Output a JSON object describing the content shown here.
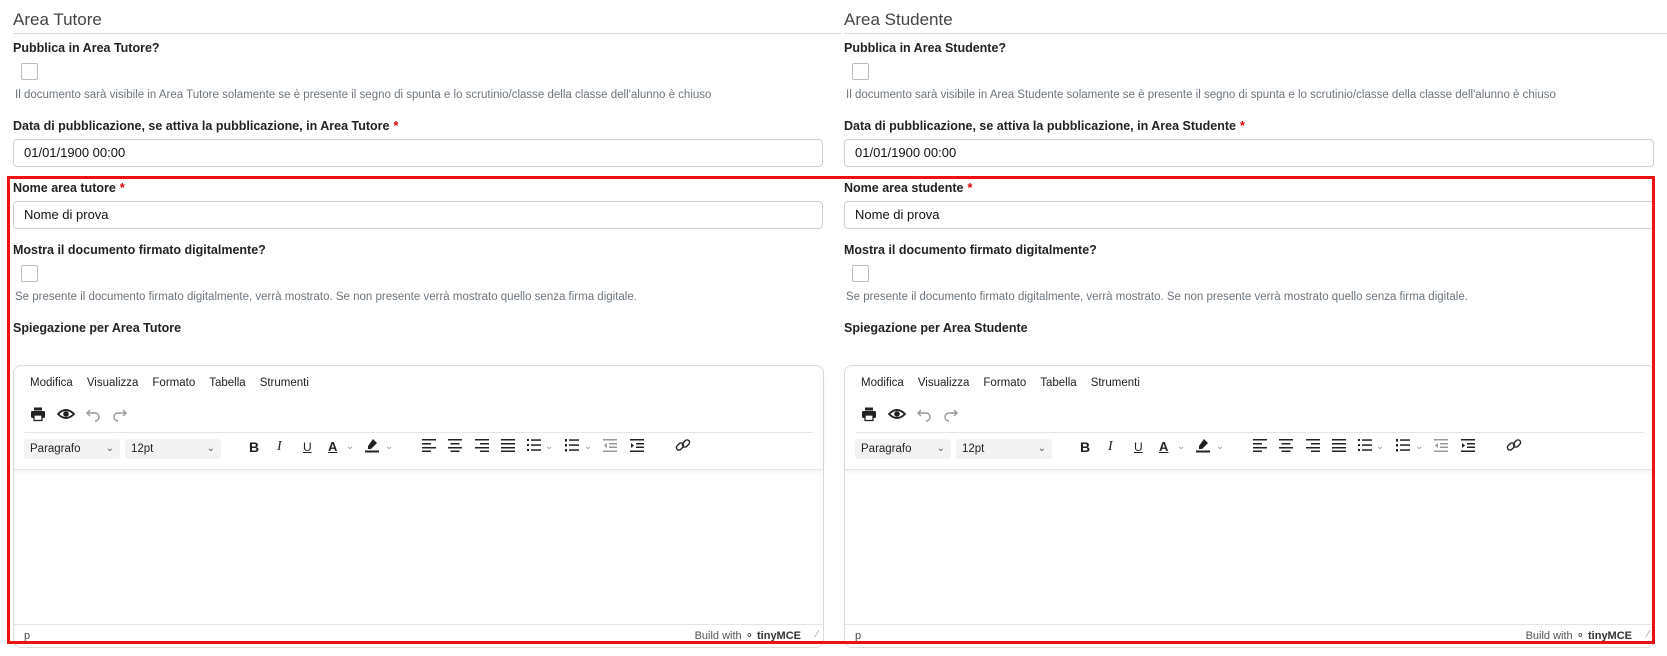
{
  "left": {
    "section_title": "Area Tutore",
    "publish_label": "Pubblica in Area Tutore?",
    "publish_help": "Il documento sarà visibile in Area Tutore solamente se è presente il segno di spunta e lo scrutinio/classe della classe dell'alunno è chiuso",
    "date_label": "Data di pubblicazione, se attiva la pubblicazione, in Area Tutore",
    "date_value": "01/01/1900 00:00",
    "name_label": "Nome area tutore",
    "name_value": "Nome di prova",
    "signed_label": "Mostra il documento firmato digitalmente?",
    "signed_help": "Se presente il documento firmato digitalmente, verrà mostrato. Se non presente verrà mostrato quello senza firma digitale.",
    "explain_label": "Spiegazione per Area Tutore"
  },
  "right": {
    "section_title": "Area Studente",
    "publish_label": "Pubblica in Area Studente?",
    "publish_help": "Il documento sarà visibile in Area Studente solamente se è presente il segno di spunta e lo scrutinio/classe della classe dell'alunno è chiuso",
    "date_label": "Data di pubblicazione, se attiva la pubblicazione, in Area Studente",
    "date_value": "01/01/1900 00:00",
    "name_label": "Nome area studente",
    "name_value": "Nome di prova",
    "signed_label": "Mostra il documento firmato digitalmente?",
    "signed_help": "Se presente il documento firmato digitalmente, verrà mostrato. Se non presente verrà mostrato quello senza firma digitale.",
    "explain_label": "Spiegazione per Area Studente"
  },
  "required_mark": "*",
  "editor": {
    "menu": [
      "Modifica",
      "Visualizza",
      "Formato",
      "Tabella",
      "Strumenti"
    ],
    "block_format": "Paragrafo",
    "font_size": "12pt",
    "status_path": "p",
    "brand_prefix": "Build with",
    "brand_name": "tinyMCE"
  },
  "colors": {
    "required": "#dd0000",
    "highlight_border": "#ee1111"
  },
  "icons": [
    "print-icon",
    "preview-icon",
    "undo-icon",
    "redo-icon",
    "bold-icon",
    "italic-icon",
    "underline-icon",
    "text-color-icon",
    "highlight-icon",
    "align-left-icon",
    "align-center-icon",
    "align-right-icon",
    "justify-icon",
    "bullet-list-icon",
    "numbered-list-icon",
    "outdent-icon",
    "indent-icon",
    "link-icon",
    "chevron-down-icon",
    "resize-grip-icon"
  ]
}
